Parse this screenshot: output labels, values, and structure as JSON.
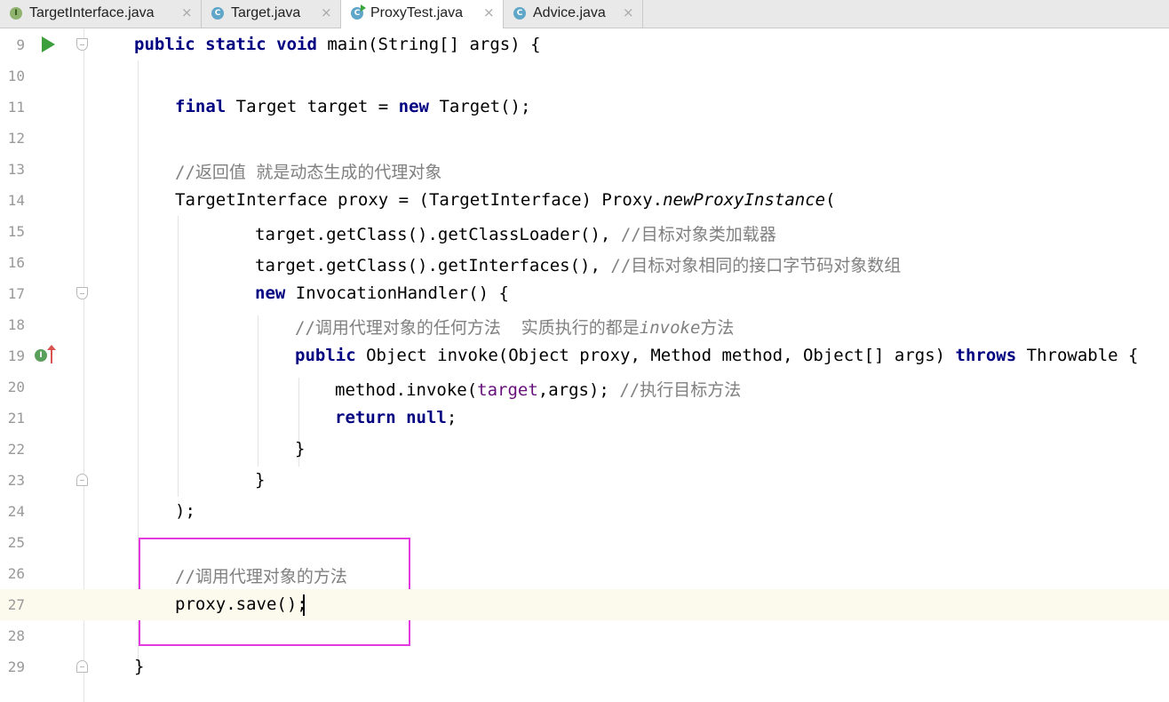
{
  "tabs": [
    {
      "icon": "interface-icon",
      "letter": "I",
      "name": "TargetInterface.java",
      "active": false
    },
    {
      "icon": "class-icon",
      "letter": "C",
      "name": "Target.java",
      "active": false
    },
    {
      "icon": "runnable-class-icon",
      "letter": "C",
      "name": "ProxyTest.java",
      "active": true
    },
    {
      "icon": "class-icon",
      "letter": "C",
      "name": "Advice.java",
      "active": false
    }
  ],
  "close_glyph": "×",
  "colors": {
    "keyword": "#000080",
    "comment": "#808080",
    "field": "#660e7a",
    "highlight_box": "#e23ae0",
    "current_line": "#fcfaed"
  },
  "editor": {
    "current_line": 27,
    "lines": [
      {
        "num": "9",
        "segments": [
          [
            "kw",
            "public static void "
          ],
          [
            "",
            "main(String[] args) {"
          ]
        ]
      },
      {
        "num": "10",
        "segments": []
      },
      {
        "num": "11",
        "segments": [
          [
            "kw",
            "final "
          ],
          [
            "",
            "Target target = "
          ],
          [
            "kw",
            "new "
          ],
          [
            "",
            "Target();"
          ]
        ]
      },
      {
        "num": "12",
        "segments": []
      },
      {
        "num": "13",
        "segments": [
          [
            "cm",
            "//返回值 就是动态生成的代理对象"
          ]
        ]
      },
      {
        "num": "14",
        "segments": [
          [
            "",
            "TargetInterface proxy = (TargetInterface) Proxy."
          ],
          [
            "it",
            "newProxyInstance"
          ],
          [
            "",
            "("
          ]
        ]
      },
      {
        "num": "15",
        "segments": [
          [
            "",
            "target.getClass().getClassLoader(), "
          ],
          [
            "cm",
            "//目标对象类加载器"
          ]
        ]
      },
      {
        "num": "16",
        "segments": [
          [
            "",
            "target.getClass().getInterfaces(), "
          ],
          [
            "cm",
            "//目标对象相同的接口字节码对象数组"
          ]
        ]
      },
      {
        "num": "17",
        "segments": [
          [
            "kw",
            "new "
          ],
          [
            "",
            "InvocationHandler() {"
          ]
        ]
      },
      {
        "num": "18",
        "segments": [
          [
            "cm",
            "//调用代理对象的任何方法  实质执行的都是"
          ],
          [
            "cm it",
            "invoke"
          ],
          [
            "cm",
            "方法"
          ]
        ]
      },
      {
        "num": "19",
        "segments": [
          [
            "kw",
            "public "
          ],
          [
            "",
            "Object invoke(Object proxy, Method method, Object[] args) "
          ],
          [
            "kw",
            "throws "
          ],
          [
            "",
            "Throwable {"
          ]
        ]
      },
      {
        "num": "20",
        "segments": [
          [
            "",
            "method.invoke("
          ],
          [
            "fld",
            "target"
          ],
          [
            "",
            ",args); "
          ],
          [
            "cm",
            "//执行目标方法"
          ]
        ]
      },
      {
        "num": "21",
        "segments": [
          [
            "kw",
            "return null"
          ],
          [
            "",
            ";"
          ]
        ]
      },
      {
        "num": "22",
        "segments": [
          [
            "",
            "}"
          ]
        ]
      },
      {
        "num": "23",
        "segments": [
          [
            "",
            "}"
          ]
        ]
      },
      {
        "num": "24",
        "segments": [
          [
            "",
            ");"
          ]
        ]
      },
      {
        "num": "25",
        "segments": []
      },
      {
        "num": "26",
        "segments": [
          [
            "cm",
            "//调用代理对象的方法"
          ]
        ]
      },
      {
        "num": "27",
        "segments": [
          [
            "",
            "proxy.save();"
          ]
        ]
      },
      {
        "num": "28",
        "segments": []
      },
      {
        "num": "29",
        "segments": [
          [
            "",
            "}"
          ]
        ]
      }
    ]
  },
  "gutter_markers": {
    "run_line": "9",
    "implements_line": "19",
    "implements_letter": "I"
  }
}
